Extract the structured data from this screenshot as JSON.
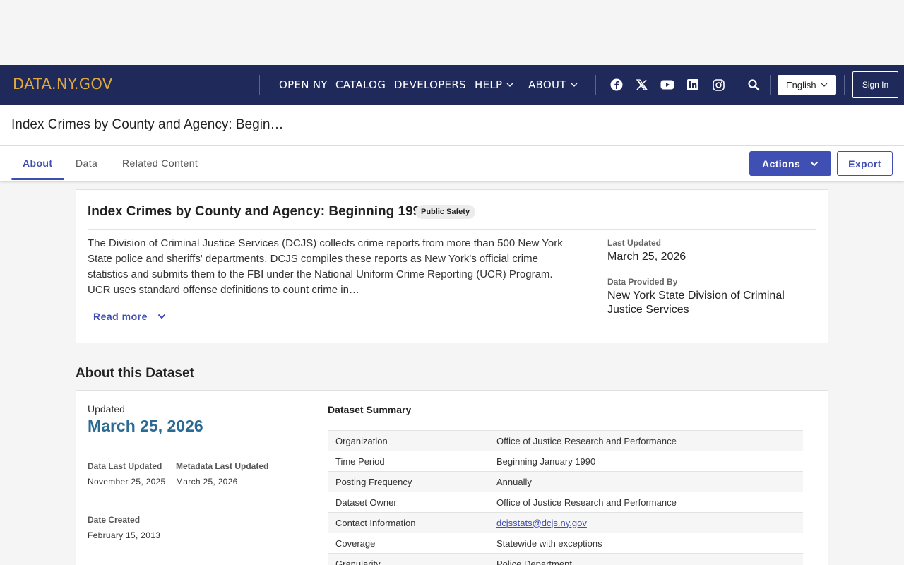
{
  "navbar": {
    "brand": "DATA.NY.GOV",
    "links": [
      {
        "label": "OPEN NY"
      },
      {
        "label": "CATALOG"
      },
      {
        "label": "DEVELOPERS"
      },
      {
        "label": "HELP"
      },
      {
        "label": "ABOUT"
      }
    ],
    "language": "English",
    "signin": "Sign In",
    "social_icons": [
      "facebook-icon",
      "x-icon",
      "youtube-icon",
      "linkedin-icon",
      "instagram-icon"
    ]
  },
  "page": {
    "title": "Index Crimes by County and Agency: Begin…"
  },
  "tabs": [
    {
      "label": "About"
    },
    {
      "label": "Data"
    },
    {
      "label": "Related Content"
    }
  ],
  "toolbar": {
    "actions": "Actions",
    "export": "Export"
  },
  "overview": {
    "title": "Index Crimes by County and Agency: Beginning 1990",
    "tag": "Public Safety",
    "description": "The Division of Criminal Justice Services (DCJS) collects crime reports from more than 500 New York State police and sheriffs' departments. DCJS compiles these reports as New York's official crime statistics and submits them to the FBI under the National Uniform Crime Reporting (UCR) Program. UCR uses standard offense definitions to count crime in…",
    "read_more": "Read more",
    "last_updated_label": "Last Updated",
    "last_updated": "March 25, 2026",
    "provided_by_label": "Data Provided By",
    "provided_by": "New York State Division of Criminal Justice Services"
  },
  "about": {
    "heading": "About this Dataset",
    "updated_label": "Updated",
    "updated": "March 25, 2026",
    "data_last_updated_label": "Data Last Updated",
    "data_last_updated": "November 25, 2025",
    "metadata_last_updated_label": "Metadata Last Updated",
    "metadata_last_updated": "March 25, 2026",
    "date_created_label": "Date Created",
    "date_created": "February 15, 2013",
    "summary_heading": "Dataset Summary",
    "summary": [
      {
        "key": "Organization",
        "value": "Office of Justice Research and Performance"
      },
      {
        "key": "Time Period",
        "value": "Beginning January 1990"
      },
      {
        "key": "Posting Frequency",
        "value": "Annually"
      },
      {
        "key": "Dataset Owner",
        "value": "Office of Justice Research and Performance"
      },
      {
        "key": "Contact Information",
        "value": "dcjsstats@dcjs.ny.gov"
      },
      {
        "key": "Coverage",
        "value": "Statewide with exceptions"
      },
      {
        "key": "Granularity",
        "value": "Police Department"
      }
    ]
  },
  "colors": {
    "navbar": "#1f2a5b",
    "brand": "#e0a93a",
    "accent": "#3e4db0",
    "date": "#2b6a93"
  }
}
